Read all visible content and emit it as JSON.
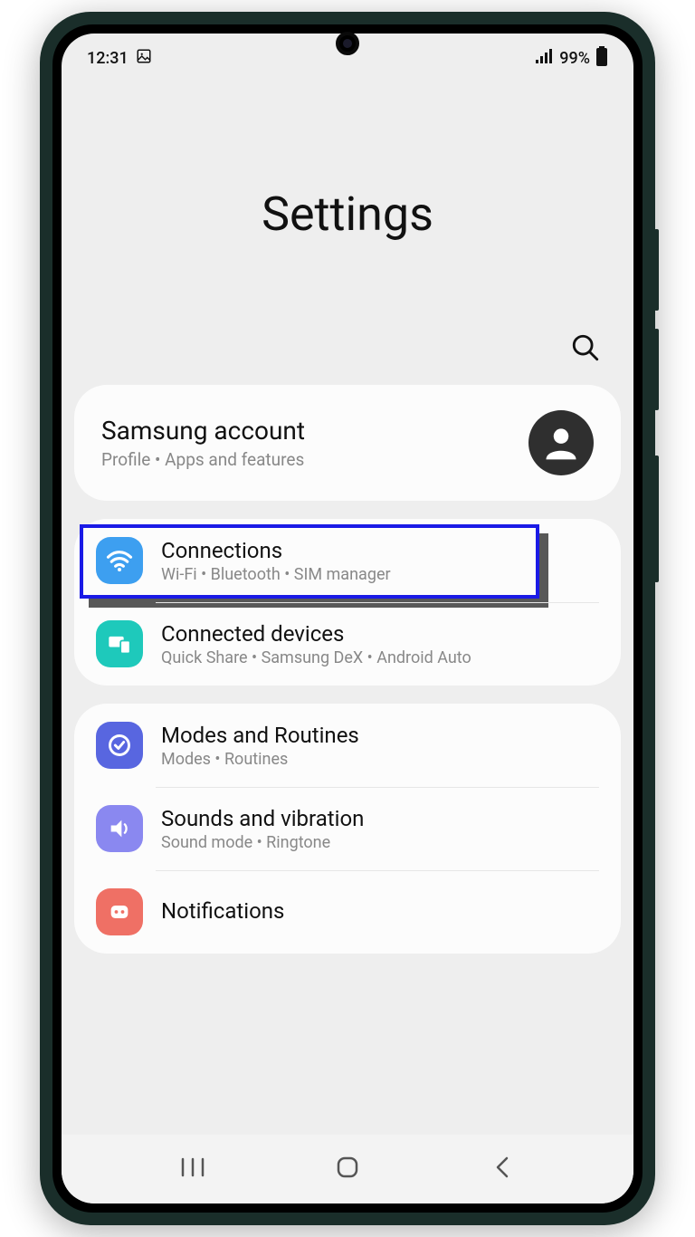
{
  "status": {
    "time": "12:31",
    "battery": "99%"
  },
  "header": {
    "title": "Settings"
  },
  "account": {
    "title": "Samsung account",
    "subtitle": "Profile  •  Apps and features"
  },
  "groups": [
    {
      "items": [
        {
          "key": "connections",
          "title": "Connections",
          "subtitle": "Wi-Fi  •  Bluetooth  •  SIM manager",
          "icon": "wifi",
          "highlighted": true
        },
        {
          "key": "connected-devices",
          "title": "Connected devices",
          "subtitle": "Quick Share  •  Samsung DeX  •  Android Auto",
          "icon": "devices"
        }
      ]
    },
    {
      "items": [
        {
          "key": "modes",
          "title": "Modes and Routines",
          "subtitle": "Modes  •  Routines",
          "icon": "modes"
        },
        {
          "key": "sounds",
          "title": "Sounds and vibration",
          "subtitle": "Sound mode  •  Ringtone",
          "icon": "sound"
        },
        {
          "key": "notifications",
          "title": "Notifications",
          "subtitle": "",
          "icon": "notif"
        }
      ]
    }
  ]
}
